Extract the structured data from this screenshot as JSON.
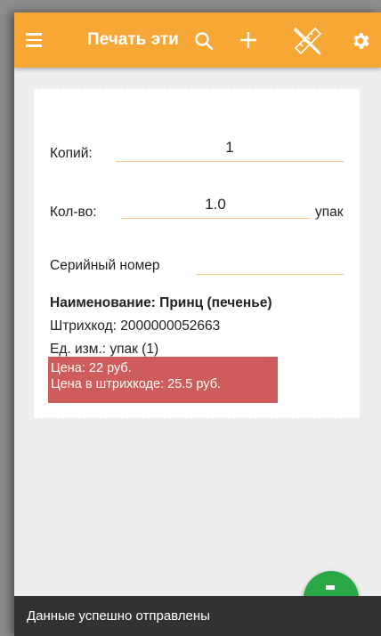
{
  "toolbar": {
    "title": "Печать этикеток",
    "icons": [
      "menu-icon",
      "search-icon",
      "add-icon",
      "ruler-pencil-icon",
      "gear-icon"
    ],
    "color": "#f7a735"
  },
  "form": {
    "copies_label": "Копий:",
    "copies_value": "1",
    "qty_label": "Кол-во:",
    "qty_value": "1.0",
    "qty_unit": "упак",
    "serial_label": "Серийный номер",
    "serial_value": ""
  },
  "product": {
    "name": "Наименование: Принц (печенье)",
    "barcode": "Штрихкод: 2000000052663",
    "unit": "Ед. изм.: упак (1)",
    "price": "Цена: 22 руб.",
    "barcode_price": "Цена в штрихкоде: 25.5 руб.",
    "price_color": "#cf5c5c"
  },
  "fab": {
    "icon": "print-icon",
    "color": "#29a745"
  },
  "snackbar": {
    "text": "Данные успешно отправлены"
  }
}
